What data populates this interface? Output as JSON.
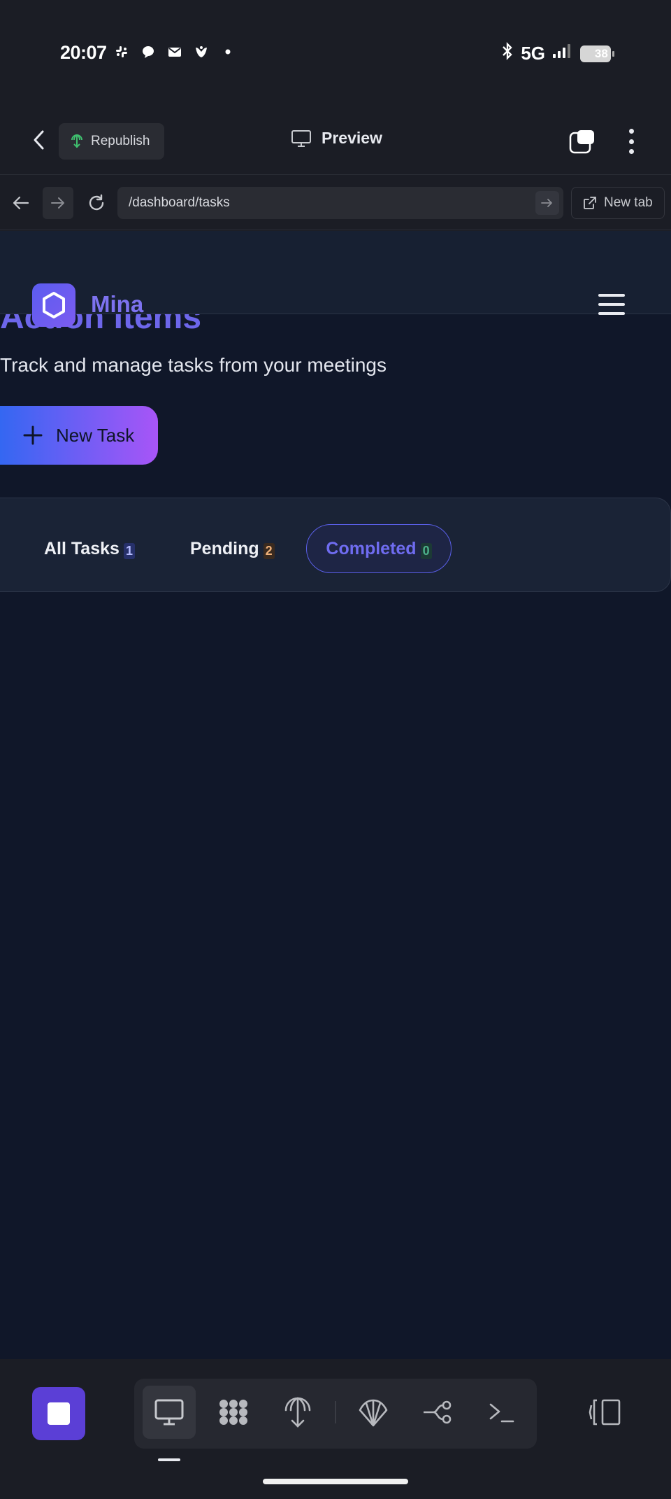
{
  "status_bar": {
    "time": "20:07",
    "network": "5G",
    "battery": "38",
    "battery_level_percent": 38,
    "left_icons": [
      "slack-icon",
      "chat-bubble-icon",
      "mail-icon",
      "bank-icon",
      "dot-icon"
    ],
    "right_icons": [
      "bluetooth-icon",
      "signal-icon",
      "battery-icon"
    ]
  },
  "app_header": {
    "republish_label": "Republish",
    "preview_label": "Preview"
  },
  "url_bar": {
    "url": "/dashboard/tasks",
    "new_tab_label": "New tab"
  },
  "site": {
    "brand": "Mina",
    "page_title": "Action Items",
    "subtitle": "Track and manage tasks from your meetings",
    "new_task_label": "New Task",
    "filters": [
      {
        "label": "All Tasks",
        "count": "1"
      },
      {
        "label": "Pending",
        "count": "2"
      },
      {
        "label": "Completed",
        "count": "0",
        "selected": true
      }
    ],
    "colors": {
      "accent": "#6d66ea",
      "button_gradient_start": "#3467f2",
      "button_gradient_end": "#a855f7",
      "background": "#101729"
    }
  },
  "bottom_toolbar": {
    "tools": [
      "monitor-icon",
      "apps-grid-icon",
      "deploy-icon",
      "shell-icon",
      "nodes-icon",
      "terminal-icon"
    ],
    "active_tool": "monitor-icon"
  }
}
